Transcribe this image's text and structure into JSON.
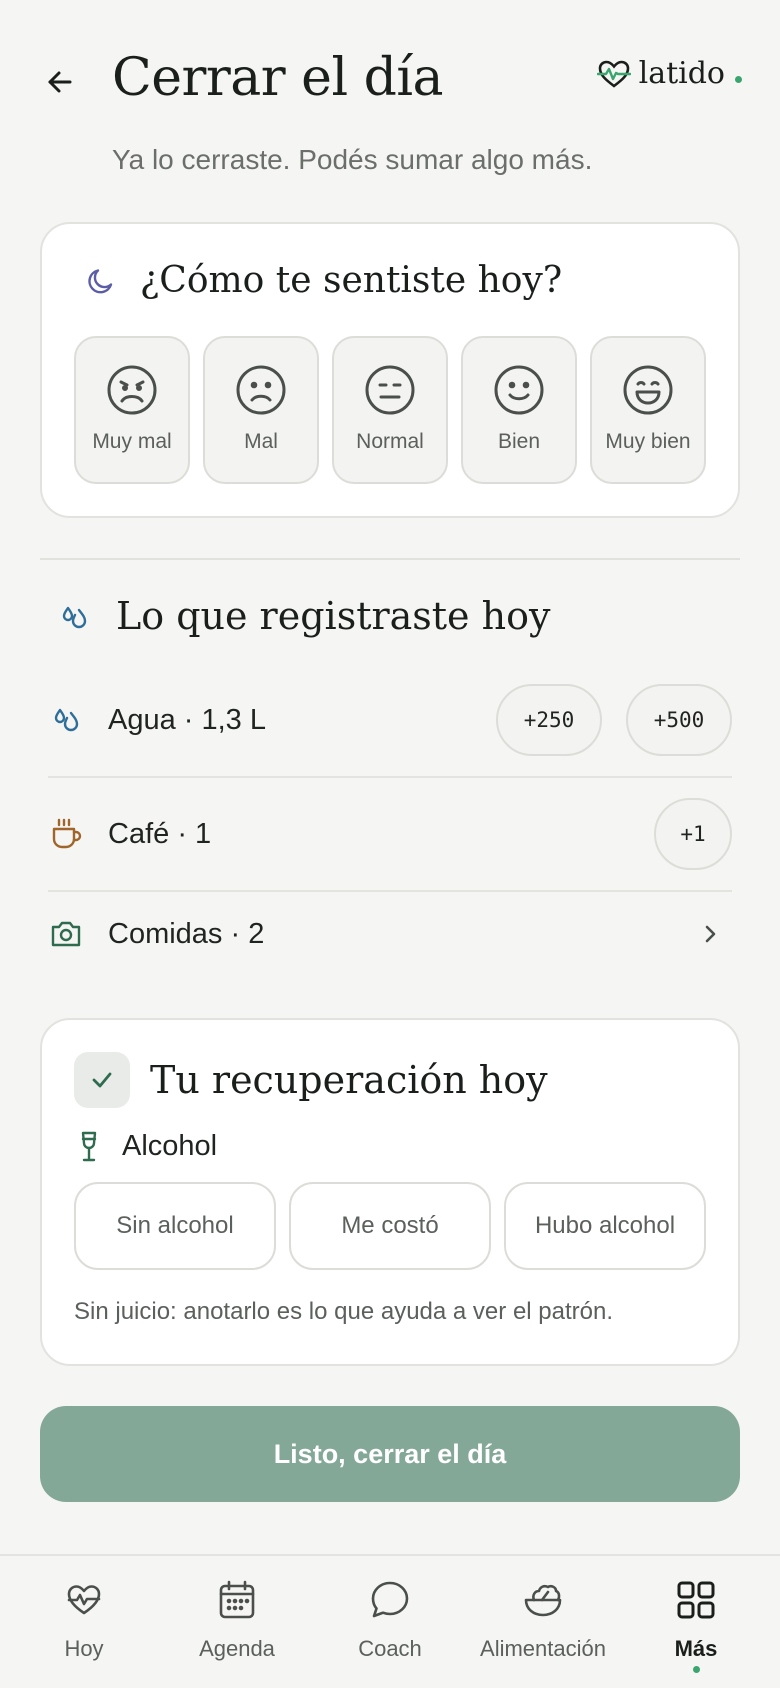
{
  "header": {
    "title": "Cerrar el día",
    "subtitle": "Ya lo cerraste. Podés sumar algo más.",
    "brand": "latido"
  },
  "mood": {
    "question": "¿Cómo te sentiste hoy?",
    "options": [
      {
        "label": "Muy mal",
        "icon": "very-sad-face-icon"
      },
      {
        "label": "Mal",
        "icon": "sad-face-icon"
      },
      {
        "label": "Normal",
        "icon": "neutral-face-icon"
      },
      {
        "label": "Bien",
        "icon": "smile-face-icon"
      },
      {
        "label": "Muy bien",
        "icon": "big-smile-face-icon"
      }
    ]
  },
  "registered": {
    "title": "Lo que registraste hoy",
    "water": {
      "label": "Agua · 1,3 L",
      "add_250": "+250",
      "add_500": "+500"
    },
    "coffee": {
      "label": "Café · 1",
      "add_1": "+1"
    },
    "meals": {
      "label": "Comidas · 2"
    }
  },
  "recovery": {
    "title": "Tu recuperación hoy",
    "alcohol_label": "Alcohol",
    "options": [
      "Sin alcohol",
      "Me costó",
      "Hubo alcohol"
    ],
    "note": "Sin juicio: anotarlo es lo que ayuda a ver el patrón."
  },
  "cta": {
    "label": "Listo, cerrar el día"
  },
  "nav": {
    "items": [
      {
        "label": "Hoy",
        "icon": "heart-pulse-icon"
      },
      {
        "label": "Agenda",
        "icon": "calendar-icon"
      },
      {
        "label": "Coach",
        "icon": "chat-bubble-icon"
      },
      {
        "label": "Alimentación",
        "icon": "salad-bowl-icon"
      },
      {
        "label": "Más",
        "icon": "grid-icon",
        "active": true
      }
    ]
  },
  "colors": {
    "accent_green": "#3aa56e",
    "cta_bg": "#84a898",
    "moon_icon": "#5b5ea6",
    "water_icon": "#2f6e9a",
    "coffee_icon": "#a0652a",
    "camera_icon": "#2e6b4f"
  }
}
